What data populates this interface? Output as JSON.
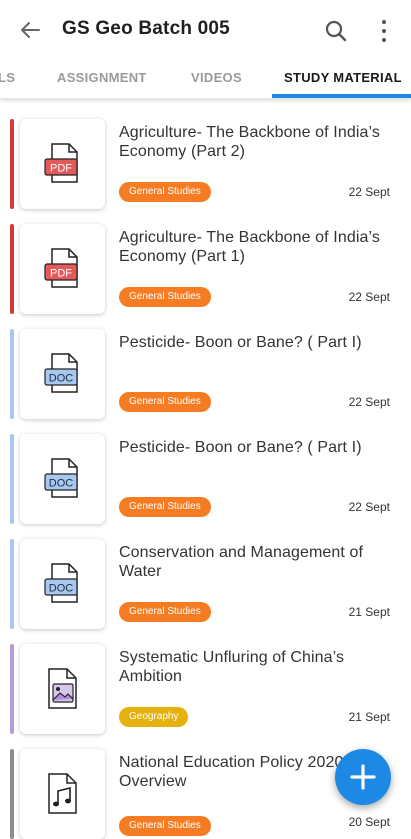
{
  "header": {
    "title": "GS Geo Batch 005"
  },
  "tabs": [
    {
      "label": "LS"
    },
    {
      "label": "ASSIGNMENT"
    },
    {
      "label": "VIDEOS"
    },
    {
      "label": "STUDY MATERIAL"
    }
  ],
  "colors": {
    "accent": "#1e88e5",
    "general_studies_tag": "#f57c22",
    "geography_tag": "#e5b10e",
    "pdf": "#d23b3b",
    "doc": "#a9c8ef"
  },
  "items": [
    {
      "title": "Agriculture- The Backbone of India’s Economy (Part 2)",
      "tag": "General Studies",
      "date": "22 Sept",
      "type": "pdf-icon"
    },
    {
      "title": "Agriculture- The Backbone of India’s Economy (Part 1)",
      "tag": "General Studies",
      "date": "22 Sept",
      "type": "pdf-icon"
    },
    {
      "title": "Pesticide- Boon or Bane? ( Part I)",
      "tag": "General Studies",
      "date": "22 Sept",
      "type": "doc-icon"
    },
    {
      "title": "Pesticide- Boon or Bane? ( Part I)",
      "tag": "General Studies",
      "date": "22 Sept",
      "type": "doc-icon"
    },
    {
      "title": "Conservation and Management of Water",
      "tag": "General Studies",
      "date": "21 Sept",
      "type": "doc-icon"
    },
    {
      "title": "Systematic Unfluring of China’s Ambition",
      "tag": "Geography",
      "date": "21 Sept",
      "type": "image-file-icon"
    },
    {
      "title": "National Education Policy 2020 Overview",
      "tag": "General Studies",
      "date": "20 Sept",
      "type": "audio-file-icon"
    }
  ],
  "icon_labels": {
    "pdf": "PDF",
    "doc": "DOC"
  }
}
